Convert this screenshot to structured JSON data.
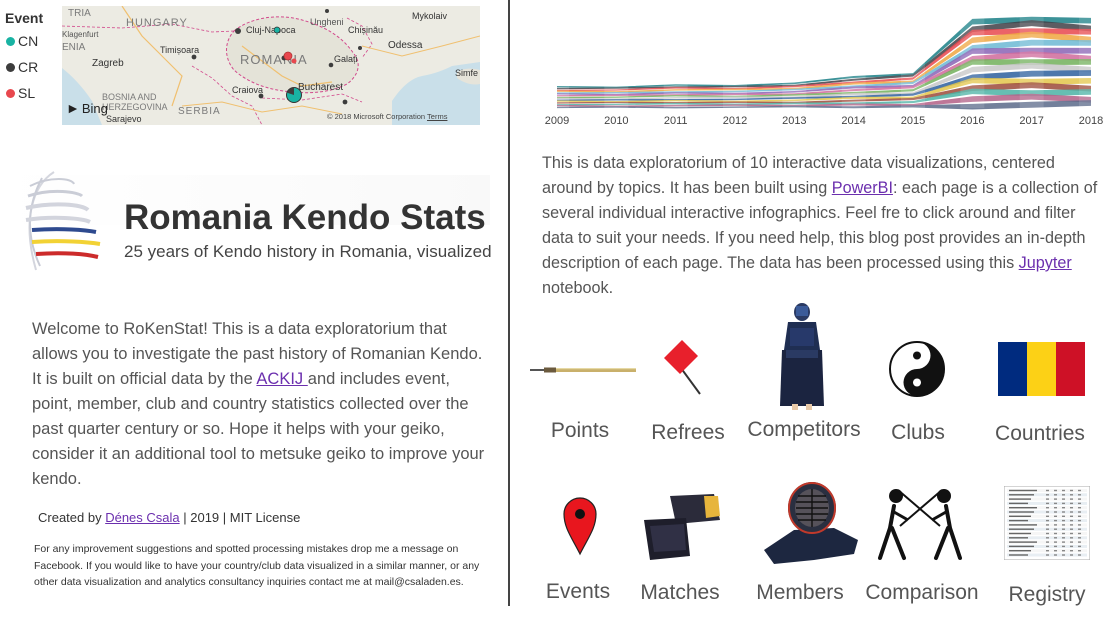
{
  "legend": {
    "title": "Event",
    "items": [
      {
        "label": "CN",
        "color": "#19b3a3"
      },
      {
        "label": "CR",
        "color": "#3d3d3d"
      },
      {
        "label": "SL",
        "color": "#e8484e"
      }
    ]
  },
  "map": {
    "labels": [
      "TRIA",
      "HUNGARY",
      "Cluj-Napoca",
      "Ungheni",
      "Chișinău",
      "Mykolaiv",
      "Klagenfurt",
      "ENIA",
      "Timișoara",
      "ROMANIA",
      "Odessa",
      "Zagreb",
      "Galați",
      "Simfe",
      "BOSNIA AND",
      "Craiova",
      "Bucharest",
      "HERZEGOVINA",
      "SERBIA",
      "Sarajevo"
    ],
    "bing": "Bing",
    "copyright": "© 2018 Microsoft Corporation",
    "terms": "Terms"
  },
  "timeline": {
    "years": [
      "2009",
      "2010",
      "2011",
      "2012",
      "2013",
      "2014",
      "2015",
      "2016",
      "2017",
      "2018"
    ]
  },
  "header": {
    "title": "Romania Kendo Stats",
    "subtitle": "25 years of Kendo history in Romania, visualized"
  },
  "welcome": {
    "text_before": "Welcome to RoKenStat! This is a data exploratorium that allows you to investigate the past history of Romanian Kendo. It is built on official data by the ",
    "link": "ACKIJ ",
    "text_after": "and includes event, point, member, club and country statistics collected over the past quarter century or so. Hope it helps with your geiko, consider it an additional tool to metsuke geiko to improve your kendo."
  },
  "credit": {
    "prefix": "Created by ",
    "author": "Dénes Csala",
    "suffix": " | 2019 | MIT License"
  },
  "contact": "For any improvement suggestions and spotted processing mistakes drop me a message on Facebook. If you would like to have your country/club data visualized in a similar manner, or any other data visualization and analytics consultancy inquiries contact me at mail@csaladen.es.",
  "about": {
    "part1": "This is data exploratorium of 10 interactive data visualizations, centered around by topics. It has been built using ",
    "link1": "PowerBI",
    "part2": ": each page is a collection of several individual interactive infographics. Feel fre  to click around and filter data to suit your needs. If you need help, this blog post provides an in-depth description of each page. The data has been processed using this ",
    "link2": "Jupyter",
    "part3": " notebook."
  },
  "nav": {
    "points": "Points",
    "refrees": "Refrees",
    "competitors": "Competitors",
    "clubs": "Clubs",
    "countries": "Countries",
    "events": "Events",
    "matches": "Matches",
    "members": "Members",
    "comparison": "Comparison",
    "registry": "Registry"
  },
  "colors": {
    "link": "#6b2fae",
    "flag_blue": "#002b7f",
    "flag_yellow": "#fcd116",
    "flag_red": "#ce1126"
  }
}
